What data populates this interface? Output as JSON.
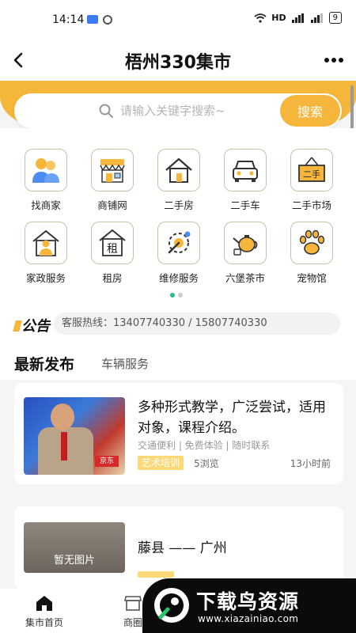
{
  "status_bar": {
    "time": "14:14",
    "network": "HD",
    "battery": "9"
  },
  "header": {
    "title": "梧州330集市"
  },
  "search": {
    "placeholder": "请输入关键字搜索~",
    "button_label": "搜索"
  },
  "categories": [
    {
      "label": "找商家",
      "icon": "people-icon"
    },
    {
      "label": "商铺网",
      "icon": "storefront-icon"
    },
    {
      "label": "二手房",
      "icon": "house-icon"
    },
    {
      "label": "二手车",
      "icon": "car-icon"
    },
    {
      "label": "二手市场",
      "icon": "secondhand-sign-icon",
      "icon_text": "二手"
    },
    {
      "label": "家政服务",
      "icon": "housekeeper-icon"
    },
    {
      "label": "租房",
      "icon": "rent-house-icon",
      "icon_text": "租"
    },
    {
      "label": "维修服务",
      "icon": "repair-tools-icon"
    },
    {
      "label": "六堡茶市",
      "icon": "teapot-icon"
    },
    {
      "label": "宠物馆",
      "icon": "paw-icon"
    }
  ],
  "carousel": {
    "pages": 2,
    "active": 1
  },
  "notice": {
    "logo_text": "公告",
    "text": "客服热线：13407740330 / 15807740330"
  },
  "tabs": {
    "latest": "最新发布",
    "vehicle": "车辆服务"
  },
  "listings": [
    {
      "title": "多种形式教学，广泛尝试，适用对象，课程介绍。",
      "tags": "交通便利 | 免费体验 | 随时联系",
      "category": "艺术培训",
      "views": "5浏览",
      "time": "13小时前",
      "image_badge": "京东"
    },
    {
      "title": "藤县 —— 广州",
      "no_image_label": "暂无图片"
    }
  ],
  "bottom_nav": {
    "home": "集市首页",
    "shop": "商圈"
  },
  "watermark": {
    "text": "下载鸟资源",
    "url": "www.xiazainiao.com"
  },
  "colors": {
    "accent": "#f6b63c",
    "active_dot": "#20c08c"
  }
}
